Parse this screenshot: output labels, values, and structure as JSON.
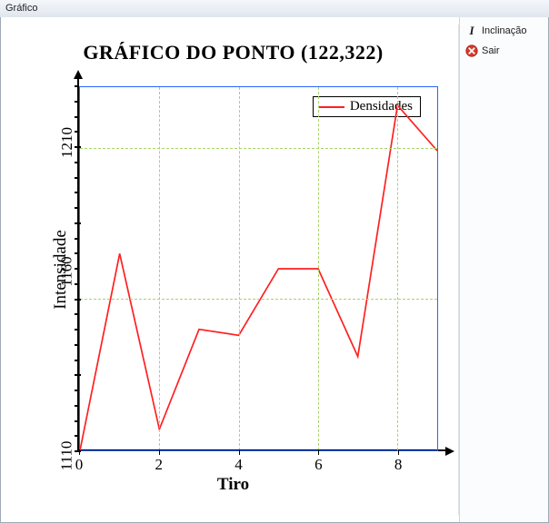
{
  "window": {
    "title": "Gráfico"
  },
  "side": {
    "items": [
      {
        "icon": "italic-icon",
        "label": "Inclinação"
      },
      {
        "icon": "exit-icon",
        "label": "Sair"
      }
    ]
  },
  "chart_data": {
    "type": "line",
    "title": "GRÁFICO DO PONTO (122,322)",
    "xlabel": "Tiro",
    "ylabel": "Intensidade",
    "xlim": [
      0,
      9
    ],
    "ylim": [
      1110,
      1230
    ],
    "xticks": [
      0,
      2,
      4,
      6,
      8
    ],
    "yticks": [
      1110,
      1160,
      1210
    ],
    "legend": {
      "label": "Densidades",
      "position": "upper-right-inside"
    },
    "series": [
      {
        "name": "Densidades",
        "x": [
          0,
          1,
          2,
          3,
          4,
          5,
          6,
          7,
          8,
          9
        ],
        "values": [
          1110,
          1175,
          1117,
          1150,
          1148,
          1170,
          1170,
          1141,
          1224,
          1209
        ]
      }
    ],
    "grid": true
  }
}
